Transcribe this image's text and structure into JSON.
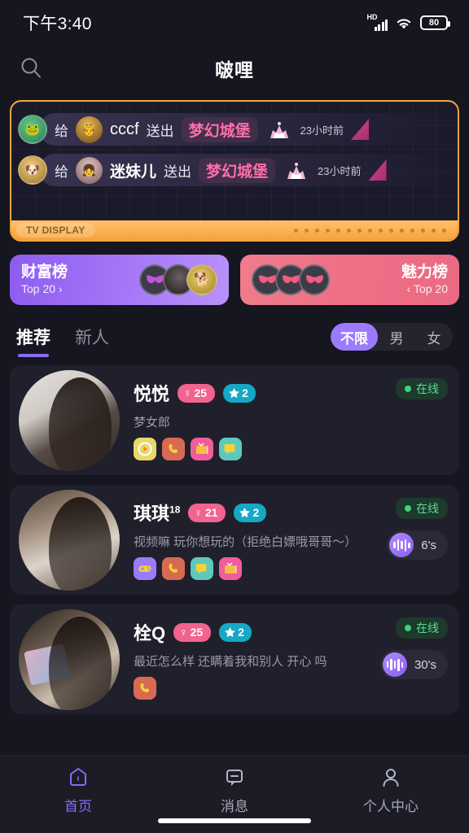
{
  "status_bar": {
    "time": "下午3:40",
    "network_label": "HD",
    "battery_level": "80",
    "icons": [
      "signal-bars-icon",
      "wifi-icon",
      "battery-icon"
    ]
  },
  "header": {
    "title": "啵哩",
    "search_icon": "search-icon"
  },
  "tv_banner": {
    "footer_label": "TV DISPLAY",
    "dot_count": 15,
    "border_color": "#f5a33c",
    "rows": [
      {
        "sender_avatar": "frog-avatar",
        "give_word": "给",
        "receiver_avatar": "gold-mask-avatar",
        "receiver_name": "cccf",
        "action_word": "送出",
        "gift_name": "梦幻城堡",
        "gift_icon": "castle-gift-icon",
        "time": "23小时前"
      },
      {
        "sender_avatar": "dog-avatar",
        "give_word": "给",
        "receiver_avatar": "girl-avatar",
        "receiver_name": "迷妹儿",
        "action_word": "送出",
        "gift_name": "梦幻城堡",
        "gift_icon": "castle-gift-icon",
        "time": "23小时前"
      }
    ]
  },
  "rankings": {
    "wealth": {
      "title": "财富榜",
      "subtitle": "Top 20 ›",
      "color": "#a678f7",
      "avatars": [
        "masked-avatar",
        "photo-avatar-dark",
        "photo-avatar-dog"
      ]
    },
    "charm": {
      "title": "魅力榜",
      "subtitle": "‹ Top 20",
      "color": "#ee6f86",
      "avatars": [
        "masked-avatar",
        "masked-avatar",
        "masked-avatar"
      ]
    }
  },
  "tabs": {
    "items": [
      {
        "label": "推荐",
        "active": true
      },
      {
        "label": "新人",
        "active": false
      }
    ],
    "accent_color": "#8a6bf5"
  },
  "gender_filter": {
    "options": [
      {
        "label": "不限",
        "active": true
      },
      {
        "label": "男",
        "active": false
      },
      {
        "label": "女",
        "active": false
      }
    ]
  },
  "users": [
    {
      "name": "悦悦",
      "age_suffix": "",
      "gender_symbol": "♀",
      "age": "25",
      "star_count": "2",
      "bio": "梦女郎",
      "status": "在线",
      "voice_duration": "",
      "action_icons": [
        "play-icon",
        "phone-icon",
        "tv-icon",
        "chat-icon"
      ]
    },
    {
      "name": "琪琪",
      "age_suffix": "18",
      "gender_symbol": "♀",
      "age": "21",
      "star_count": "2",
      "bio": "视频嘛 玩你想玩的（拒绝白嫖哦哥哥～）",
      "status": "在线",
      "voice_duration": "6's",
      "action_icons": [
        "game-icon",
        "phone-icon",
        "chat-icon",
        "tv-icon"
      ]
    },
    {
      "name": "栓Q",
      "age_suffix": "",
      "gender_symbol": "♀",
      "age": "25",
      "star_count": "2",
      "bio": "最近怎么样 还瞒着我和别人 开心 吗",
      "status": "在线",
      "voice_duration": "30's",
      "action_icons": [
        "phone-icon"
      ]
    }
  ],
  "bottom_nav": {
    "items": [
      {
        "label": "首页",
        "icon": "home-icon",
        "active": true
      },
      {
        "label": "消息",
        "icon": "message-icon",
        "active": false
      },
      {
        "label": "个人中心",
        "icon": "profile-icon",
        "active": false
      }
    ]
  }
}
